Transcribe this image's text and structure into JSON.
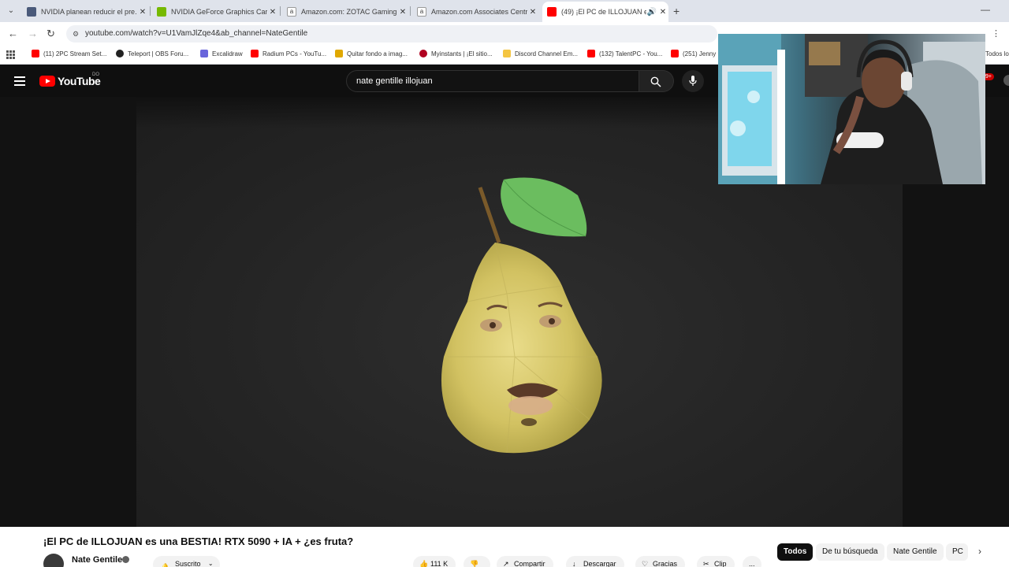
{
  "browser": {
    "tabs": [
      {
        "title": "NVIDIA planean reducir el pre...",
        "icon": "news-favicon-icon",
        "color": "#4a5a7a"
      },
      {
        "title": "NVIDIA GeForce Graphics Card...",
        "icon": "nvidia-favicon-icon",
        "color": "#76b900"
      },
      {
        "title": "Amazon.com: ZOTAC Gaming G...",
        "icon": "amazon-favicon-icon",
        "color": "#222222"
      },
      {
        "title": "Amazon.com Associates Centra...",
        "icon": "amazon-favicon-icon",
        "color": "#222222"
      },
      {
        "title": "(49) ¡El PC de ILLOJUAN es...",
        "icon": "youtube-favicon-icon",
        "color": "#ff0000"
      }
    ],
    "url": "youtube.com/watch?v=U1VamJlZqe4&ab_channel=NateGentile",
    "bookmarks": [
      {
        "label": "(11) 2PC Stream Set...",
        "color": "#ff0000"
      },
      {
        "label": "Teleport | OBS Foru...",
        "color": "#222222"
      },
      {
        "label": "Excalidraw",
        "color": "#6965db"
      },
      {
        "label": "Radium PCs - YouTu...",
        "color": "#ff0000"
      },
      {
        "label": "Quitar fondo a imag...",
        "color": "#e0a800"
      },
      {
        "label": "Myinstants | ¡El sitio...",
        "color": "#b00020"
      },
      {
        "label": "Discord Channel Em...",
        "color": "#f4c542"
      },
      {
        "label": "(132) TalentPC - You...",
        "color": "#ff0000"
      },
      {
        "label": "(251) Jenny",
        "color": "#ff0000"
      }
    ],
    "bookmarks_right": "Todos lo"
  },
  "youtube": {
    "logo_text": "YouTube",
    "country": "DO",
    "search_value": "nate gentille illojuan",
    "notif_count": "9+",
    "video_title": "¡El PC de ILLOJUAN es una BESTIA! RTX 5090 + IA + ¿es fruta?",
    "channel_name": "Nate Gentile",
    "subscribe_label": "Suscrito",
    "actions": {
      "likes": "111 K",
      "share": "Compartir",
      "download": "Descargar",
      "thanks": "Gracias",
      "clip": "Clip",
      "more": "..."
    },
    "chips": [
      "Todos",
      "De tu búsqueda",
      "Nate Gentile",
      "PC"
    ]
  },
  "colors": {
    "accent": "#ff0000",
    "pear": "#d6c96a",
    "leaf": "#5fb35a"
  }
}
